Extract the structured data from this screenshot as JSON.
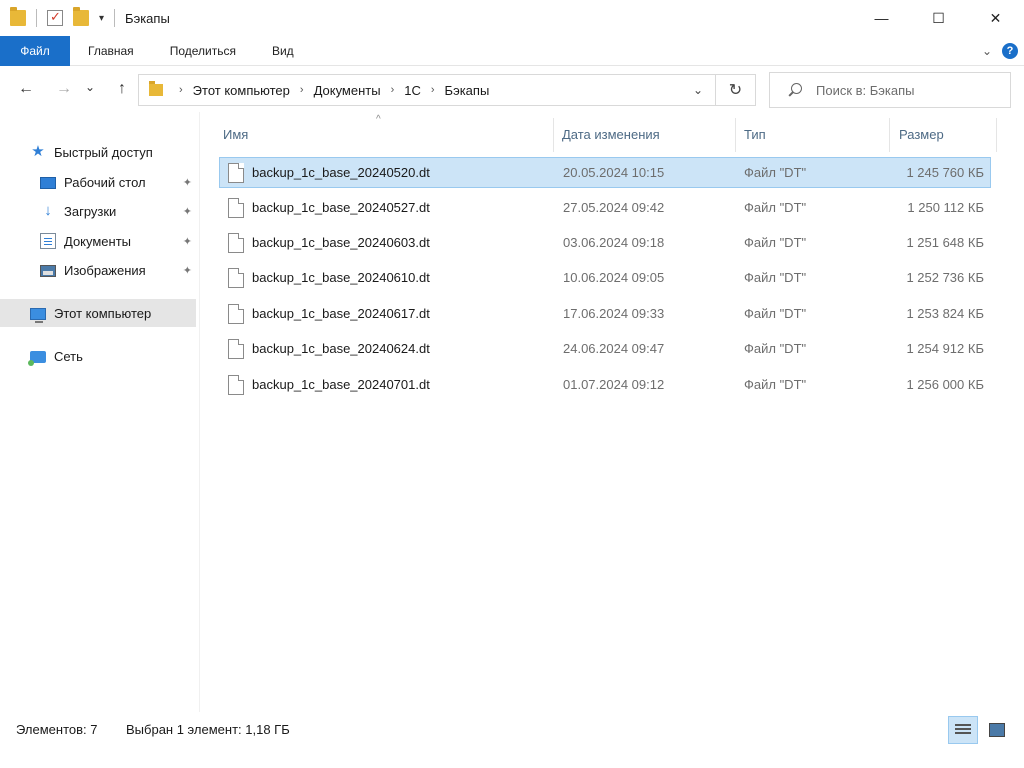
{
  "window": {
    "title": "Бэкапы",
    "controls": {
      "minimize": "—",
      "maximize": "☐",
      "close": "✕"
    }
  },
  "ribbon": {
    "tabs": [
      "Файл",
      "Главная",
      "Поделиться",
      "Вид"
    ],
    "collapse_icon": "chevron-down-icon",
    "help": "?"
  },
  "nav": {
    "back": "←",
    "forward": "→",
    "recent": "⌄",
    "up": "↑",
    "breadcrumbs": [
      "Этот компьютер",
      "Документы",
      "1С",
      "Бэкапы"
    ],
    "refresh": "↻",
    "search_placeholder": "Поиск в: Бэкапы"
  },
  "sidebar": {
    "items": [
      {
        "label": "Быстрый доступ",
        "icon": "star-icon"
      },
      {
        "label": "Рабочий стол",
        "icon": "desktop-icon",
        "pinned": true
      },
      {
        "label": "Загрузки",
        "icon": "download-icon",
        "pinned": true
      },
      {
        "label": "Документы",
        "icon": "documents-icon",
        "pinned": true
      },
      {
        "label": "Изображения",
        "icon": "pictures-icon",
        "pinned": true
      },
      {
        "label": "Этот компьютер",
        "icon": "computer-icon",
        "selected": true
      },
      {
        "label": "Сеть",
        "icon": "network-icon"
      }
    ],
    "pin_glyph": "📌"
  },
  "columns": {
    "name": "Имя",
    "date": "Дата изменения",
    "type": "Тип",
    "size": "Размер",
    "sort_arrow": "^"
  },
  "files": [
    {
      "name": "backup_1c_base_20240520.dt",
      "date": "20.05.2024 10:15",
      "type": "Файл \"DT\"",
      "size": "1 245 760 КБ",
      "selected": true
    },
    {
      "name": "backup_1c_base_20240527.dt",
      "date": "27.05.2024 09:42",
      "type": "Файл \"DT\"",
      "size": "1 250 112 КБ"
    },
    {
      "name": "backup_1c_base_20240603.dt",
      "date": "03.06.2024 09:18",
      "type": "Файл \"DT\"",
      "size": "1 251 648 КБ"
    },
    {
      "name": "backup_1c_base_20240610.dt",
      "date": "10.06.2024 09:05",
      "type": "Файл \"DT\"",
      "size": "1 252 736 КБ"
    },
    {
      "name": "backup_1c_base_20240617.dt",
      "date": "17.06.2024 09:33",
      "type": "Файл \"DT\"",
      "size": "1 253 824 КБ"
    },
    {
      "name": "backup_1c_base_20240624.dt",
      "date": "24.06.2024 09:47",
      "type": "Файл \"DT\"",
      "size": "1 254 912 КБ"
    },
    {
      "name": "backup_1c_base_20240701.dt",
      "date": "01.07.2024 09:12",
      "type": "Файл \"DT\"",
      "size": "1 256 000 КБ"
    }
  ],
  "status": {
    "count": "Элементов: 7",
    "selection": "Выбран 1 элемент: 1,18 ГБ"
  },
  "colors": {
    "accent": "#1a6fc9",
    "selection_bg": "#cce4f7",
    "selection_border": "#99c9ef"
  }
}
